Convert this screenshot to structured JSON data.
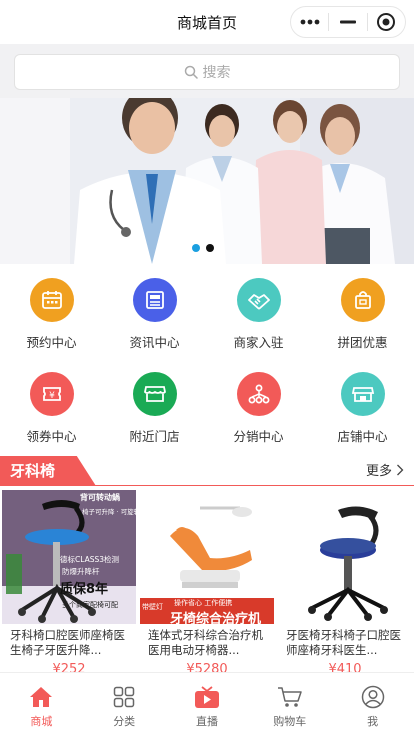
{
  "navbar": {
    "title": "商城首页"
  },
  "search": {
    "placeholder": "搜索"
  },
  "banner": {
    "slide_count": 2,
    "active_index": 0
  },
  "colors": {
    "accent": "#f25a58",
    "dot_active": "#1a9fe0",
    "dot_inactive": "#111111"
  },
  "categories": [
    {
      "label": "预约中心",
      "icon": "calendar-icon",
      "color": "#f0a020"
    },
    {
      "label": "资讯中心",
      "icon": "news-icon",
      "color": "#4a60e8"
    },
    {
      "label": "商家入驻",
      "icon": "handshake-icon",
      "color": "#4cc9c0"
    },
    {
      "label": "拼团优惠",
      "icon": "shopping-bag-icon",
      "color": "#f0a020"
    },
    {
      "label": "领券中心",
      "icon": "coupon-icon",
      "color": "#f25a58"
    },
    {
      "label": "附近门店",
      "icon": "store-icon",
      "color": "#1aaa55"
    },
    {
      "label": "分销中心",
      "icon": "distribution-icon",
      "color": "#f25a58"
    },
    {
      "label": "店铺中心",
      "icon": "shop-icon",
      "color": "#4cc9c0"
    }
  ],
  "section": {
    "title": "牙科椅",
    "more_label": "更多"
  },
  "products": [
    {
      "name": "牙科椅口腔医师座椅医生椅子牙医升降...",
      "price": "¥252",
      "image_text": {
        "top": "背可转动鍋",
        "sub": "椅子可升降 · 可旋转",
        "mid": "德标CLASS3检测",
        "mid2": "防爆升降杆",
        "big": "质保8年",
        "bottom": "多个商家配椅可配"
      }
    },
    {
      "name": "连体式牙科综合治疗机医用电动牙椅器...",
      "price": "¥5280",
      "image_text": {
        "tag": "操作省心 工作便携",
        "side": "带壁灯",
        "banner": "牙椅综合治疗机"
      }
    },
    {
      "name": "牙医椅牙科椅子口腔医师座椅牙科医生...",
      "price": "¥410"
    }
  ],
  "tabbar": [
    {
      "label": "商城",
      "icon": "home-icon",
      "active": true
    },
    {
      "label": "分类",
      "icon": "category-grid-icon",
      "active": false
    },
    {
      "label": "直播",
      "icon": "live-tv-icon",
      "active": false
    },
    {
      "label": "购物车",
      "icon": "cart-icon",
      "active": false
    },
    {
      "label": "我",
      "icon": "user-icon",
      "active": false
    }
  ]
}
